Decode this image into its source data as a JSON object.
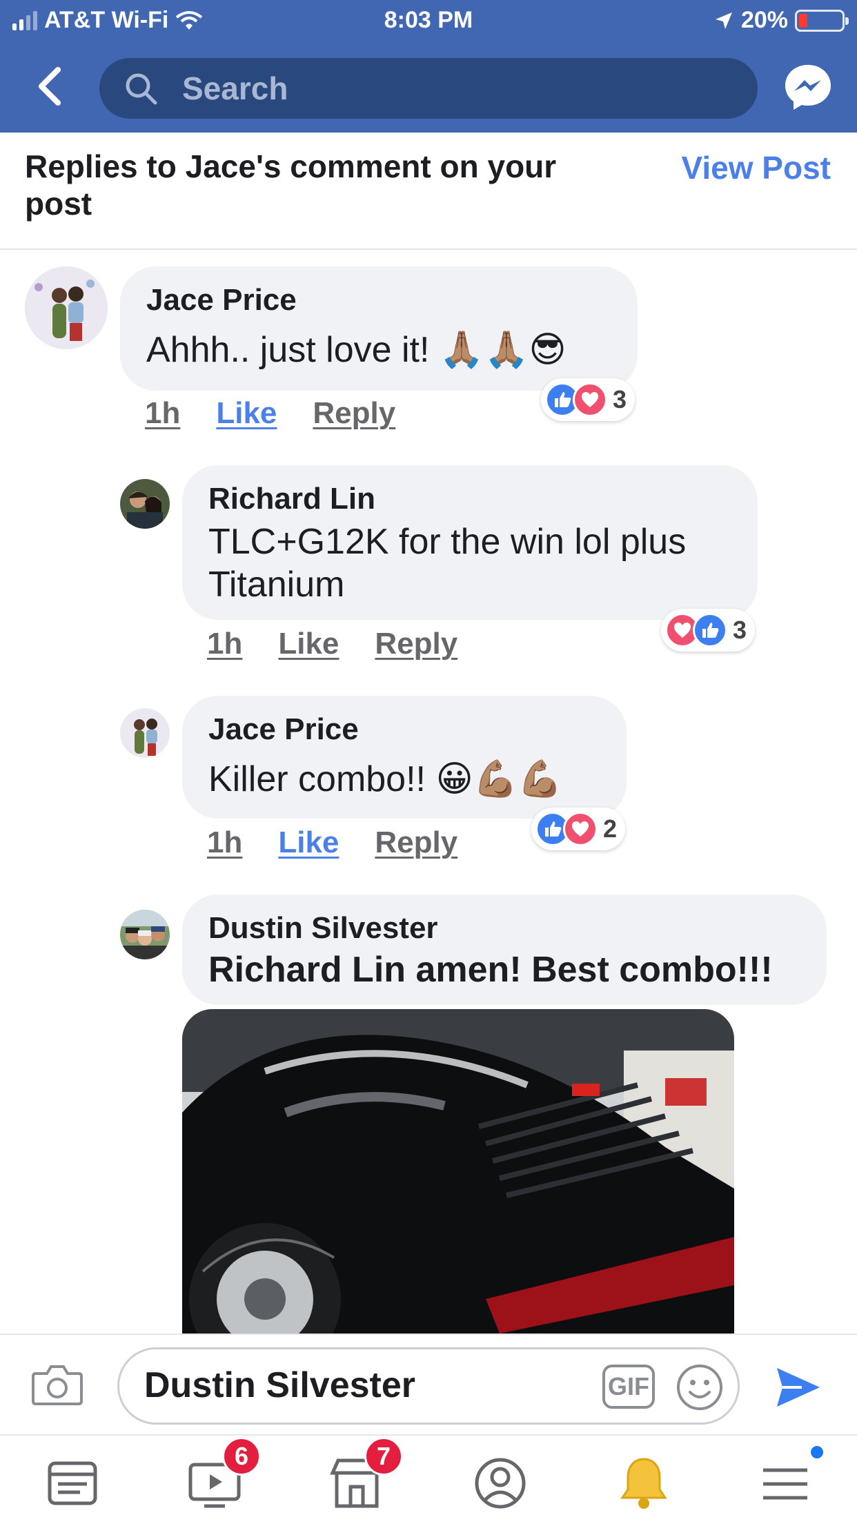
{
  "status_bar": {
    "carrier": "AT&T Wi-Fi",
    "time": "8:03 PM",
    "battery": "20%",
    "battery_level": 0.2
  },
  "nav": {
    "search_placeholder": "Search",
    "icons": [
      "back-chevron-icon",
      "search-icon",
      "messenger-icon"
    ]
  },
  "header": {
    "title": "Replies to Jace's comment on your post",
    "view_post": "View Post"
  },
  "comments": [
    {
      "name": "Jace Price",
      "text": "Ahhh.. just love it! 🙏🏽🙏🏽😎",
      "time": "1h",
      "like": "Like",
      "reply": "Reply",
      "liked": true,
      "reactions": [
        "like",
        "love"
      ],
      "reaction_count": "3"
    },
    {
      "name": "Richard Lin",
      "text": "TLC+G12K for the win lol plus Titanium",
      "time": "1h",
      "like": "Like",
      "reply": "Reply",
      "liked": false,
      "reactions": [
        "love",
        "like"
      ],
      "reaction_count": "3"
    },
    {
      "name": "Jace Price",
      "text": "Killer combo!! 😀💪🏽💪🏽",
      "time": "1h",
      "like": "Like",
      "reply": "Reply",
      "liked": true,
      "reactions": [
        "like",
        "love"
      ],
      "reaction_count": "2"
    },
    {
      "name": "Dustin Silvester",
      "text": "Richard Lin amen!  Best combo!!!",
      "attachment": "photo"
    }
  ],
  "composer": {
    "value": "Dustin Silvester",
    "gif_label": "GIF"
  },
  "tabbar": {
    "items": [
      {
        "icon": "news-feed-icon"
      },
      {
        "icon": "watch-icon",
        "badge": "6"
      },
      {
        "icon": "marketplace-icon",
        "badge": "7"
      },
      {
        "icon": "profile-icon"
      },
      {
        "icon": "notifications-bell-icon"
      },
      {
        "icon": "menu-icon"
      }
    ]
  },
  "colors": {
    "brand_blue": "#4267b2",
    "search_bg": "#29487d",
    "link_blue": "#4a80e8",
    "bubble_bg": "#f0f2f5",
    "badge_red": "#e41e3f"
  }
}
